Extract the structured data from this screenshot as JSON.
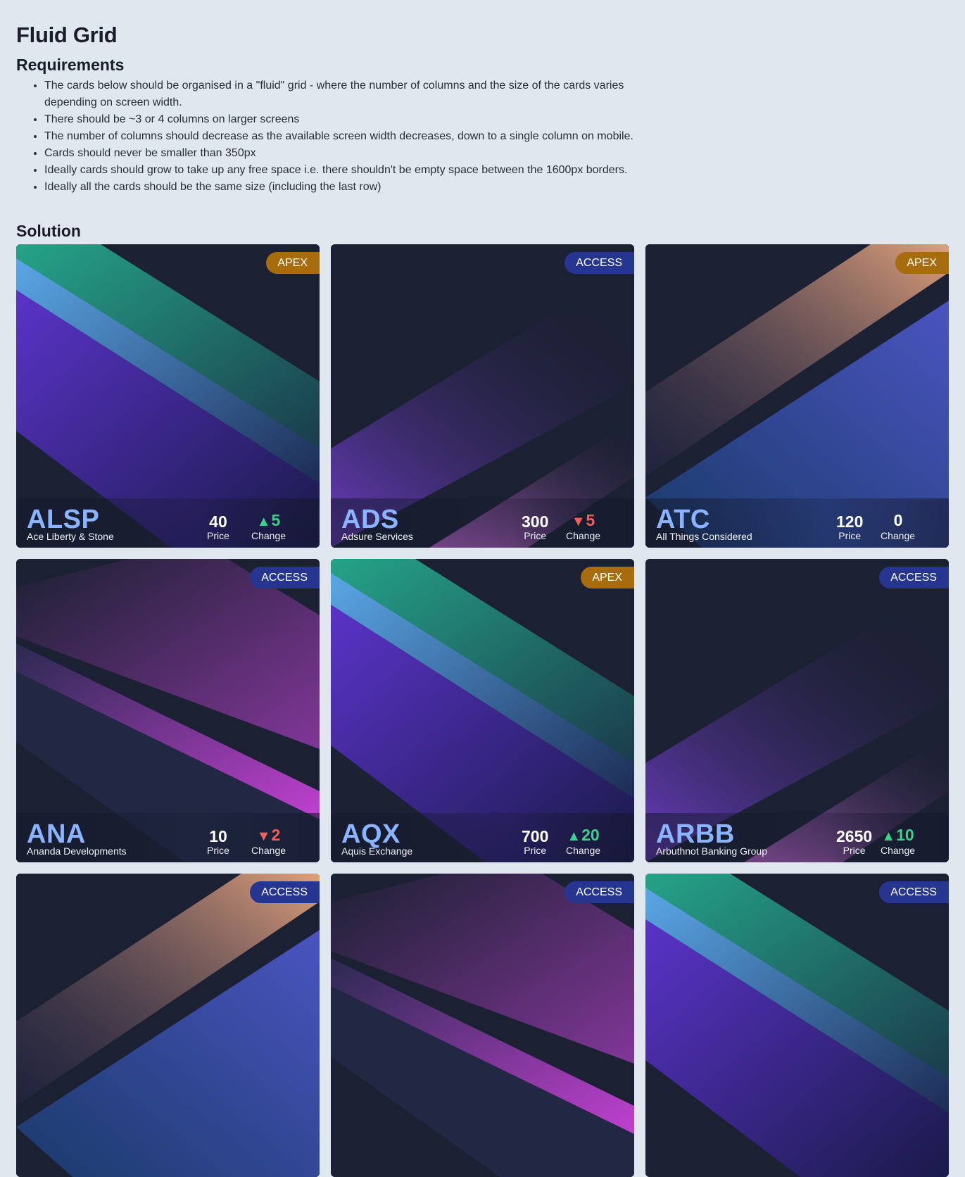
{
  "title": "Fluid Grid",
  "requirements_heading": "Requirements",
  "requirements": [
    "The cards below should be organised in a \"fluid\" grid - where the number of columns and the size of the cards varies depending on screen width.",
    "There should be ~3 or 4 columns on larger screens",
    "The number of columns should decrease as the available screen width decreases, down to a single column on mobile.",
    "Cards should never be smaller than 350px",
    "Ideally cards should grow to take up any free space i.e. there shouldn't be empty space between the 1600px borders.",
    "Ideally all the cards should be the same size (including the last row)"
  ],
  "solution_heading": "Solution",
  "labels": {
    "price": "Price",
    "change": "Change"
  },
  "cards": [
    {
      "ticker": "ALSP",
      "company": "Ace Liberty & Stone",
      "badge": "APEX",
      "price": "40",
      "change": "5",
      "direction": "up",
      "arrow": "▲",
      "art": "teal-violet"
    },
    {
      "ticker": "ADS",
      "company": "Adsure Services",
      "badge": "ACCESS",
      "price": "300",
      "change": "5",
      "direction": "down",
      "arrow": "▼",
      "art": "violet-rise"
    },
    {
      "ticker": "ATC",
      "company": "All Things Considered",
      "badge": "APEX",
      "price": "120",
      "change": "0",
      "direction": "flat",
      "arrow": "",
      "art": "peach-blue"
    },
    {
      "ticker": "ANA",
      "company": "Ananda Developments",
      "badge": "ACCESS",
      "price": "10",
      "change": "2",
      "direction": "down",
      "arrow": "▼",
      "art": "magenta-fall"
    },
    {
      "ticker": "AQX",
      "company": "Aquis Exchange",
      "badge": "APEX",
      "price": "700",
      "change": "20",
      "direction": "up",
      "arrow": "▲",
      "art": "teal-violet"
    },
    {
      "ticker": "ARBB",
      "company": "Arbuthnot Banking Group",
      "badge": "ACCESS",
      "price": "2650",
      "change": "10",
      "direction": "up",
      "arrow": "▲",
      "art": "violet-rise"
    },
    {
      "ticker": "",
      "company": "",
      "badge": "ACCESS",
      "price": "",
      "change": "",
      "direction": "flat",
      "arrow": "",
      "art": "peach-blue"
    },
    {
      "ticker": "",
      "company": "",
      "badge": "ACCESS",
      "price": "",
      "change": "",
      "direction": "flat",
      "arrow": "",
      "art": "magenta-fall"
    },
    {
      "ticker": "",
      "company": "",
      "badge": "ACCESS",
      "price": "",
      "change": "",
      "direction": "flat",
      "arrow": "",
      "art": "teal-violet"
    }
  ]
}
